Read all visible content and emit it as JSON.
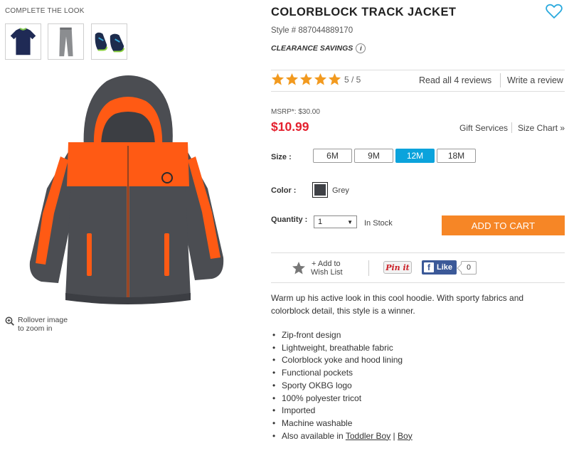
{
  "complete_the_look": {
    "label": "COMPLETE THE LOOK",
    "thumbnails": [
      "navy-tee-thumbnail",
      "grey-pants-thumbnail",
      "sneakers-thumbnail"
    ]
  },
  "zoom_hint": {
    "line1": "Rollover image",
    "line2": "to zoom in"
  },
  "product": {
    "title": "COLORBLOCK TRACK JACKET",
    "style": "Style # 887044889170",
    "clearance": "CLEARANCE SAVINGS",
    "info_icon": "i"
  },
  "rating": {
    "stars_filled": 5,
    "text": "5 / 5",
    "read_reviews": "Read all 4 reviews",
    "write_review": "Write a review"
  },
  "pricing": {
    "msrp": "MSRP*: $30.00",
    "price": "$10.99",
    "gift_services": "Gift Services",
    "size_chart": "Size Chart »"
  },
  "size": {
    "label": "Size :",
    "options": [
      "6M",
      "9M",
      "12M",
      "18M"
    ],
    "selected": "12M"
  },
  "color": {
    "label": "Color :",
    "name": "Grey",
    "swatch_hex": "#3f4146"
  },
  "quantity": {
    "label": "Quantity :",
    "value": "1",
    "stock": "In Stock"
  },
  "add_to_cart": "ADD TO CART",
  "social": {
    "wishlist_line1": "+ Add to",
    "wishlist_line2": "Wish List",
    "pinit": "Pin it",
    "fb_like": "Like",
    "fb_count": "0"
  },
  "description": "Warm up his active look in this cool hoodie. With sporty fabrics and colorblock detail, this style is a winner.",
  "features": [
    "Zip-front design",
    "Lightweight, breathable fabric",
    "Colorblock yoke and hood lining",
    "Functional pockets",
    "Sporty OKBG logo",
    "100% polyester tricot",
    "Imported",
    "Machine washable"
  ],
  "also_available": {
    "prefix": "Also available in ",
    "link1": "Toddler Boy",
    "sep": " | ",
    "link2": "Boy"
  },
  "colors": {
    "accent_orange": "#f68626",
    "price_red": "#e4202e",
    "selected_blue": "#0ba3dc",
    "star_orange": "#f29a1f",
    "jacket_grey": "#4b4d52"
  }
}
